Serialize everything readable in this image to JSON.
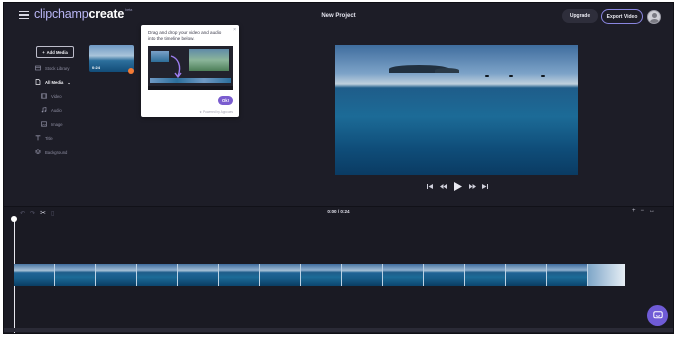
{
  "header": {
    "logo_part1": "clipchamp",
    "logo_part2": "create",
    "logo_badge": "beta",
    "project_title": "New Project",
    "upgrade_label": "Upgrade",
    "export_label": "Export Video"
  },
  "sidebar": {
    "add_media_label": "Add Media",
    "items": [
      {
        "label": "Stock Library",
        "icon": "library-icon"
      },
      {
        "label": "All Media",
        "icon": "file-icon"
      },
      {
        "label": "Video",
        "icon": "film-icon"
      },
      {
        "label": "Audio",
        "icon": "music-icon"
      },
      {
        "label": "Image",
        "icon": "image-icon"
      },
      {
        "label": "Title",
        "icon": "title-icon"
      },
      {
        "label": "Background",
        "icon": "layers-icon"
      }
    ]
  },
  "media": {
    "clip_duration": "0:24"
  },
  "tooltip": {
    "text": "Drag and drop your video and audio into the timeline below.",
    "ok_label": "Ok!",
    "powered_by": "★ Powered by Appcues"
  },
  "timeline": {
    "time_display": "0:00 / 0:24"
  },
  "colors": {
    "background": "#1d1d27",
    "accent": "#7a5ccf",
    "badge_orange": "#f47b35"
  }
}
